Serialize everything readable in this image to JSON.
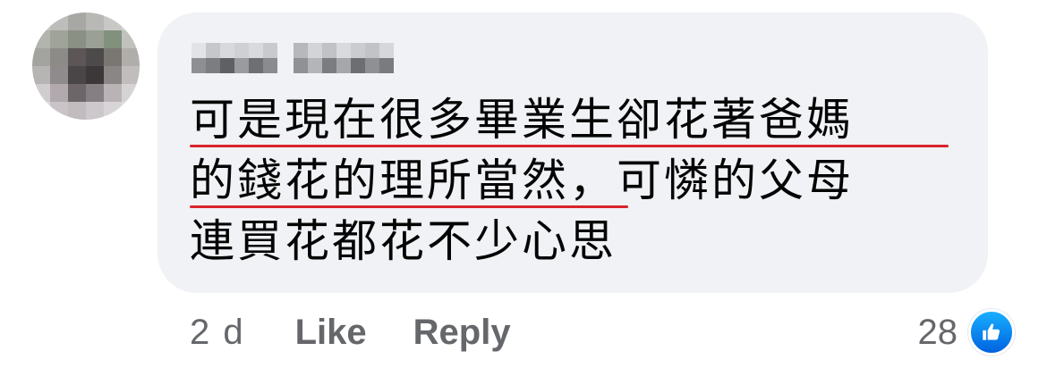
{
  "comment": {
    "text_lines": [
      "可是現在很多畢業生卻花著爸媽",
      "的錢花的理所當然，可憐的父母",
      "連買花都花不少心思"
    ],
    "underline_color": "#d9232b"
  },
  "actions": {
    "time": "2 d",
    "like_label": "Like",
    "reply_label": "Reply"
  },
  "reactions": {
    "count": "28",
    "icon": "thumbs-up-icon",
    "badge_color": "#1877f2"
  },
  "colors": {
    "bubble_bg": "#f0f2f5",
    "text": "#050505",
    "secondary_text": "#65676b"
  }
}
